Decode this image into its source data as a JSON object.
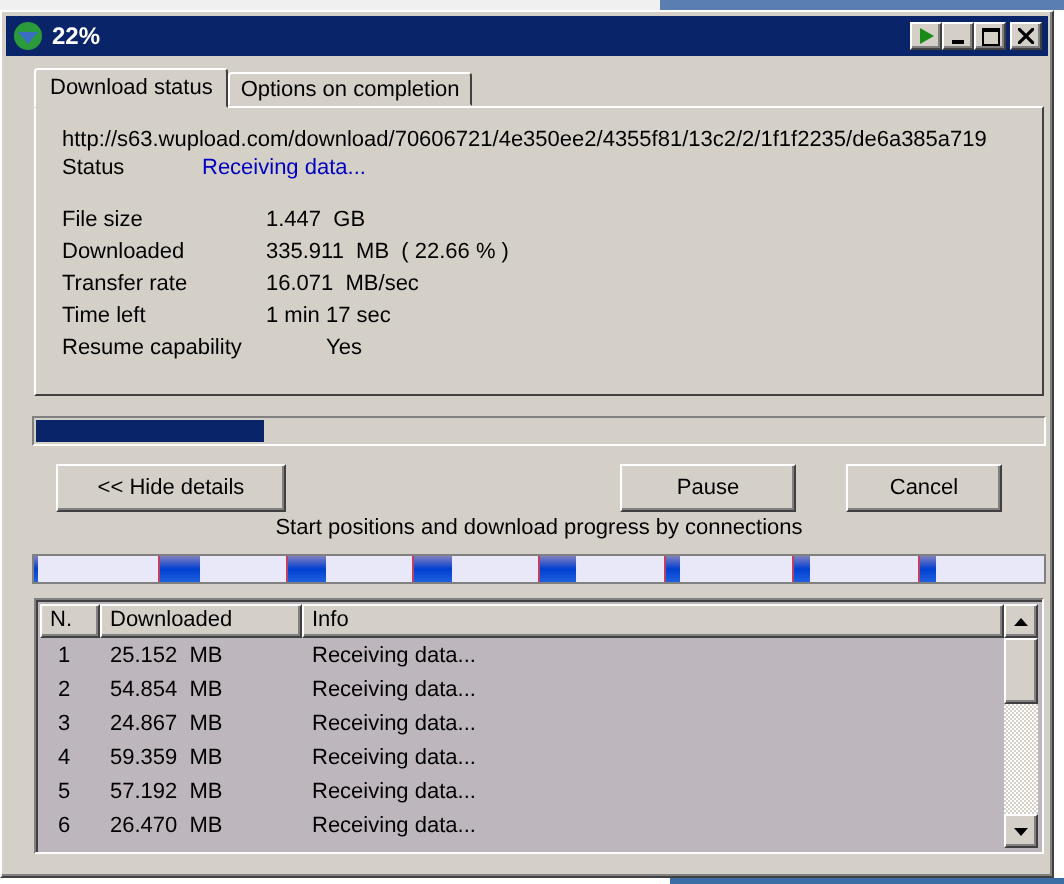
{
  "window": {
    "title": "22%"
  },
  "tabs": [
    {
      "label": "Download status",
      "selected": true
    },
    {
      "label": "Options on completion",
      "selected": false
    }
  ],
  "url": "http://s63.wupload.com/download/70606721/4e350ee2/4355f81/13c2/2/1f1f2235/de6a385a719",
  "status": {
    "label": "Status",
    "value": "Receiving data..."
  },
  "details": [
    {
      "label": "File size",
      "value": "1.447  GB",
      "kind": "value"
    },
    {
      "label": "Downloaded",
      "value": "335.911  MB  ( 22.66 % )",
      "kind": "value"
    },
    {
      "label": "Transfer rate",
      "value": "16.071  MB/sec",
      "kind": "value"
    },
    {
      "label": "Time left",
      "value": "1 min 17 sec",
      "kind": "value"
    },
    {
      "label": "Resume capability",
      "value": "Yes",
      "kind": "flag"
    }
  ],
  "progress": {
    "level": 0.2266
  },
  "buttons": [
    "<< Hide details",
    "Pause",
    "Cancel"
  ],
  "connections": {
    "caption": "Start positions and download progress by connections",
    "segments": [
      {
        "level": 0.04
      },
      {
        "level": 0.32
      },
      {
        "level": 0.31
      },
      {
        "level": 0.31
      },
      {
        "level": 0.29
      },
      {
        "level": 0.11
      },
      {
        "level": 0.13
      },
      {
        "level": 0.13
      }
    ]
  },
  "table": {
    "columns": [
      "N.",
      "Downloaded",
      "Info"
    ],
    "rows": [
      [
        "1",
        "25.152  MB",
        "Receiving data..."
      ],
      [
        "2",
        "54.854  MB",
        "Receiving data..."
      ],
      [
        "3",
        "24.867  MB",
        "Receiving data..."
      ],
      [
        "4",
        "59.359  MB",
        "Receiving data..."
      ],
      [
        "5",
        "57.192  MB",
        "Receiving data..."
      ],
      [
        "6",
        "26.470  MB",
        "Receiving data..."
      ]
    ]
  }
}
